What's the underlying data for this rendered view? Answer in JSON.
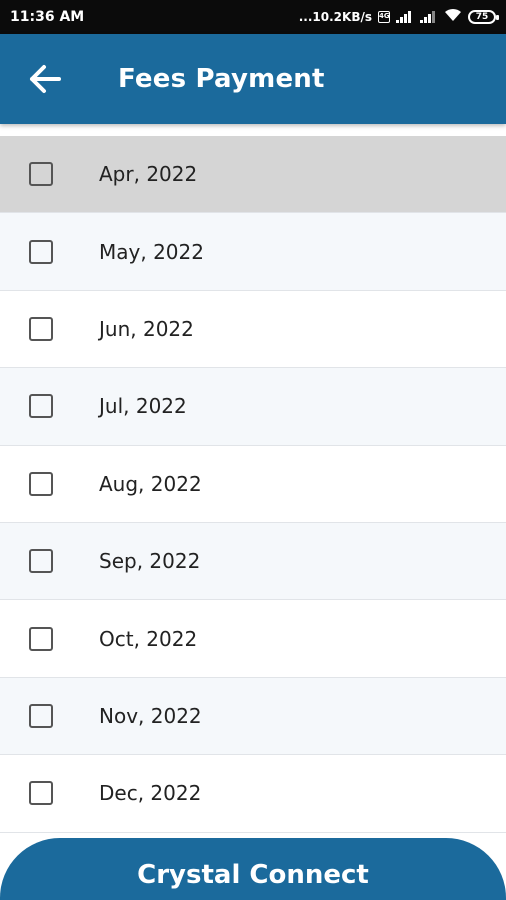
{
  "status_bar": {
    "time": "11:36 AM",
    "network_speed": "...10.2KB/s",
    "battery_level": "75"
  },
  "header": {
    "title": "Fees Payment",
    "back_icon": "arrow-left-icon"
  },
  "months": [
    {
      "label": "Apr, 2022",
      "checked": false
    },
    {
      "label": "May, 2022",
      "checked": false
    },
    {
      "label": "Jun, 2022",
      "checked": false
    },
    {
      "label": "Jul, 2022",
      "checked": false
    },
    {
      "label": "Aug, 2022",
      "checked": false
    },
    {
      "label": "Sep, 2022",
      "checked": false
    },
    {
      "label": "Oct, 2022",
      "checked": false
    },
    {
      "label": "Nov, 2022",
      "checked": false
    },
    {
      "label": "Dec, 2022",
      "checked": false
    }
  ],
  "footer": {
    "label": "Crystal Connect"
  },
  "colors": {
    "primary": "#1b6a9c",
    "highlight_row": "#d5d5d5",
    "alt_row": "#f5f8fb"
  }
}
